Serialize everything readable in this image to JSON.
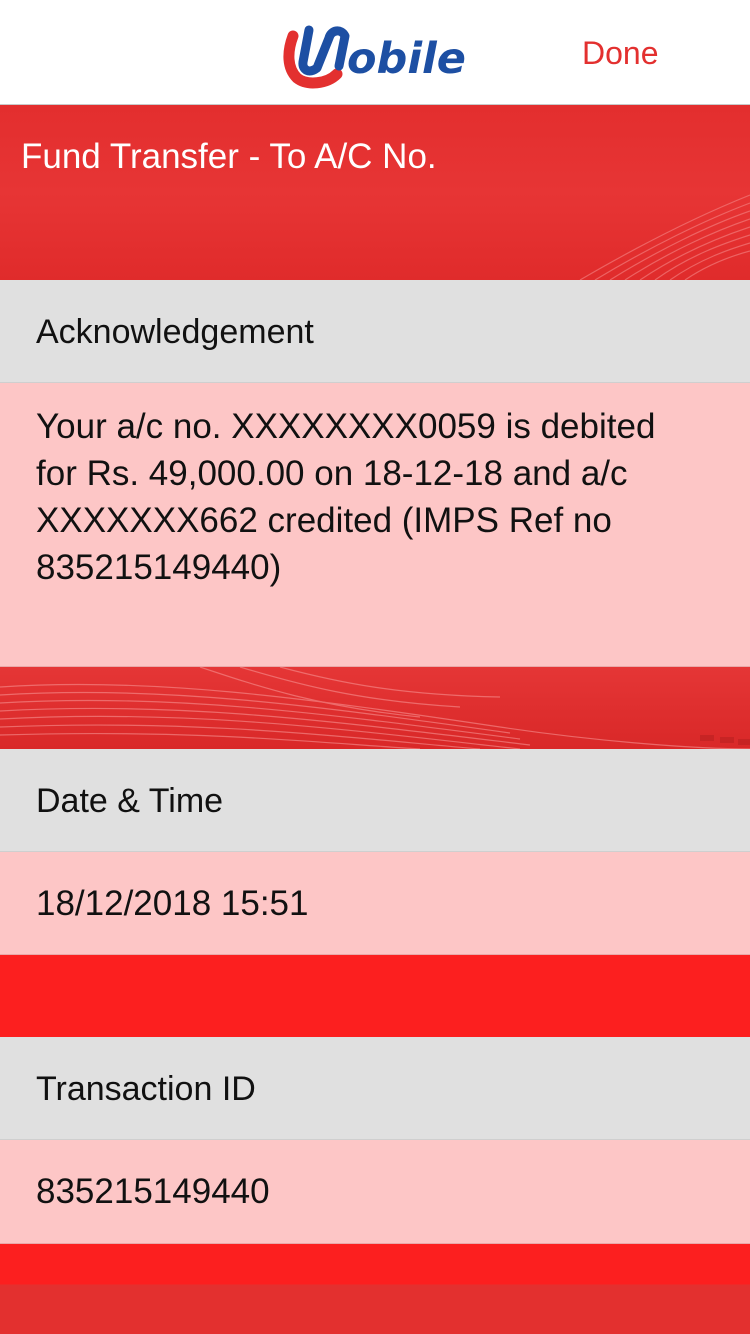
{
  "nav": {
    "logo_text": "obile",
    "logo_alt": "Umobile",
    "done_label": "Done"
  },
  "header": {
    "title": "Fund Transfer - To A/C No."
  },
  "sections": [
    {
      "label": "Acknowledgement",
      "value": "Your a/c no. XXXXXXXX0059 is debited for Rs. 49,000.00 on 18-12-18 and a/c XXXXXXX662 credited (IMPS Ref no 835215149440)"
    },
    {
      "label": "Date & Time",
      "value": "18/12/2018 15:51"
    },
    {
      "label": "Transaction ID",
      "value": "835215149440"
    }
  ],
  "colors": {
    "brand_red": "#e3302f",
    "brand_blue": "#1d4fa3",
    "label_bg": "#e0e0e0",
    "value_bg": "#fdc6c6"
  }
}
